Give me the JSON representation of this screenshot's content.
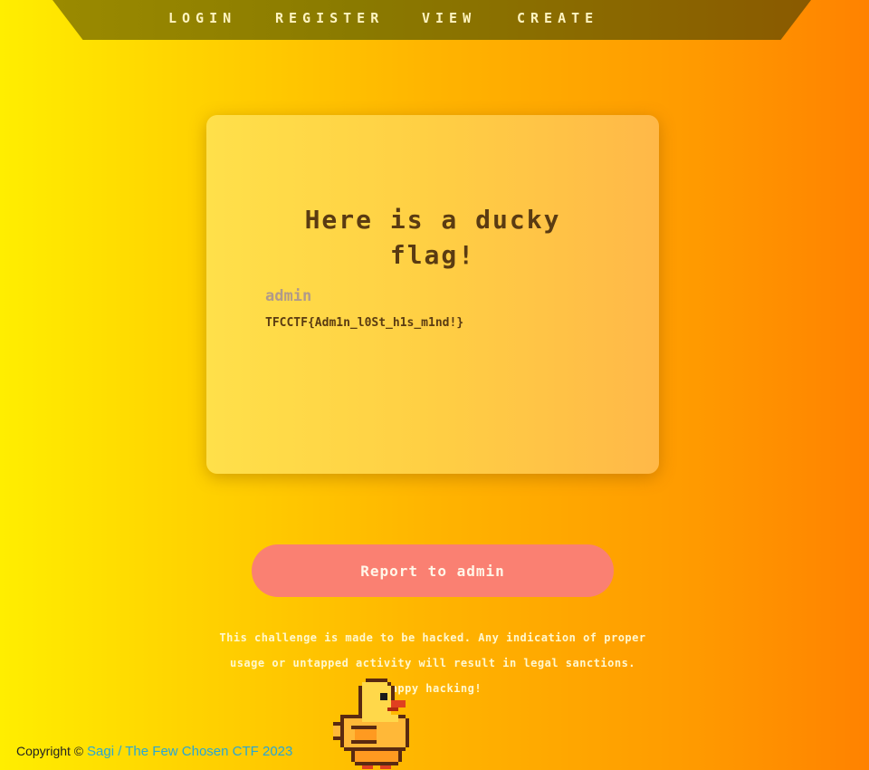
{
  "nav": {
    "items": [
      "LOGIN",
      "REGISTER",
      "VIEW",
      "CREATE"
    ]
  },
  "card": {
    "title": "Here is a ducky flag!",
    "username": "admin",
    "flag": "TFCCTF{Adm1n_l0St_h1s_m1nd!}"
  },
  "report_button": "Report to admin",
  "disclaimer": {
    "line1": "This challenge is made to be hacked. Any indication of proper",
    "line2": "usage or untapped activity will result in legal sanctions.",
    "line3": "Happy hacking!"
  },
  "footer": {
    "prefix": "Copyright ©",
    "link": "Sagi / The Few Chosen CTF 2023"
  },
  "icons": {
    "mascot": "pixel-duck-icon"
  }
}
